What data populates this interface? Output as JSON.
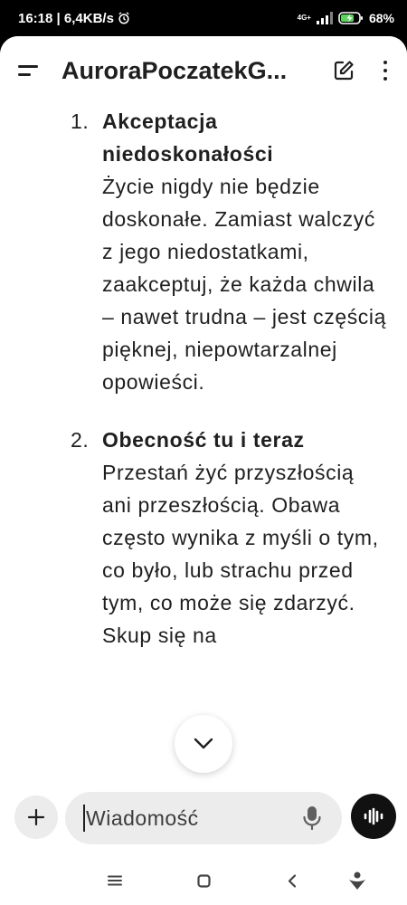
{
  "status_bar": {
    "time_speed": "16:18 | 6,4KB/s",
    "network": "4G+",
    "battery": "68%"
  },
  "header": {
    "title": "AuroraPoczatekG..."
  },
  "content": {
    "items": [
      {
        "number": "1.",
        "heading": "Akceptacja niedoskonałości",
        "body": "Życie nigdy nie będzie doskonałe. Zamiast walczyć z jego niedostatkami, zaakceptuj, że każda chwila – nawet trudna – jest częścią pięknej, niepowtarzalnej opowieści."
      },
      {
        "number": "2.",
        "heading": "Obecność tu i teraz",
        "body": "Przestań żyć przyszłością ani przeszłością. Obawa często wynika z myśli o tym, co było, lub strachu przed tym, co może się zdarzyć. Skup się na"
      }
    ]
  },
  "composer": {
    "placeholder": "Wiadomość"
  },
  "icons": {
    "menu": "menu-icon",
    "edit": "edit-icon",
    "more": "more-vertical-icon",
    "scroll": "chevron-down-icon",
    "add": "plus-icon",
    "mic": "microphone-icon",
    "voice": "waveform-icon"
  },
  "colors": {
    "background": "#ffffff",
    "text": "#1f1f1f",
    "field": "#ececec",
    "voice_button": "#111111"
  }
}
